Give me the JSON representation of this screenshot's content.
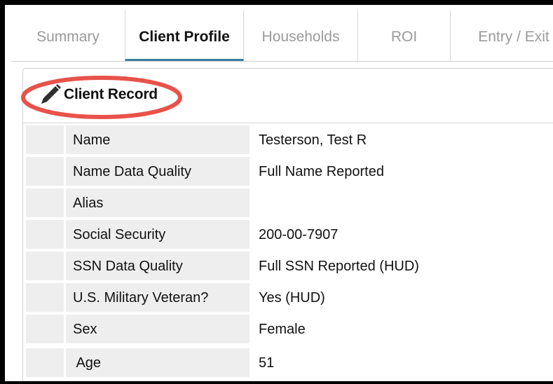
{
  "tabs": [
    {
      "label": "Summary",
      "active": false
    },
    {
      "label": "Client Profile",
      "active": true
    },
    {
      "label": "Households",
      "active": false
    },
    {
      "label": "ROI",
      "active": false
    },
    {
      "label": "Entry / Exit",
      "active": false
    }
  ],
  "panel": {
    "title": "Client Record",
    "icon": "pencil-icon",
    "highlight_color": "#e8524a"
  },
  "record": [
    {
      "label": "Name",
      "value": "Testerson, Test R"
    },
    {
      "label": "Name Data Quality",
      "value": "Full Name Reported"
    },
    {
      "label": "Alias",
      "value": ""
    },
    {
      "label": "Social Security",
      "value": "200-00-7907"
    },
    {
      "label": "SSN Data Quality",
      "value": "Full SSN Reported (HUD)"
    },
    {
      "label": "U.S. Military Veteran?",
      "value": "Yes (HUD)"
    },
    {
      "label": "Sex",
      "value": "Female"
    },
    {
      "label": " Age",
      "value": "51"
    }
  ],
  "colors": {
    "active_tab_underline": "#3a7ea3",
    "label_background": "#eeeeee",
    "inactive_tab_text": "#9a9a9a"
  }
}
